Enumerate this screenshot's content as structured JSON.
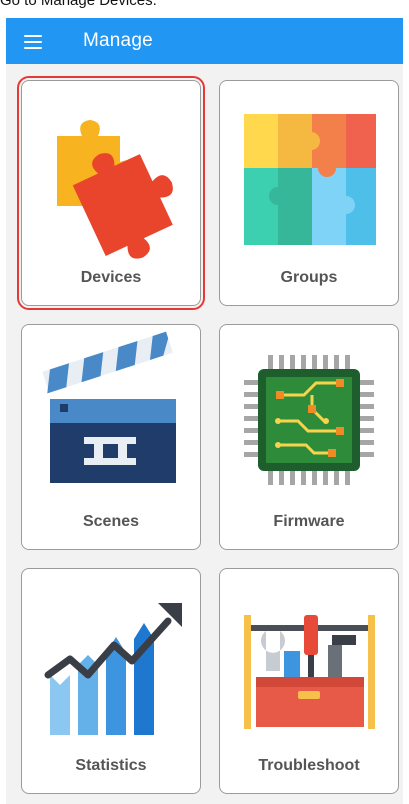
{
  "caption": "Go to Manage Devices.",
  "appbar": {
    "title": "Manage",
    "menu_icon": "menu-icon",
    "color": "#2196f3"
  },
  "cards": [
    {
      "label": "Devices",
      "icon": "puzzle-pieces-icon",
      "selected": true
    },
    {
      "label": "Groups",
      "icon": "puzzle-grid-icon",
      "selected": false
    },
    {
      "label": "Scenes",
      "icon": "clapperboard-icon",
      "selected": false
    },
    {
      "label": "Firmware",
      "icon": "chip-icon",
      "selected": false
    },
    {
      "label": "Statistics",
      "icon": "growth-chart-icon",
      "selected": false
    },
    {
      "label": "Troubleshoot",
      "icon": "toolbox-icon",
      "selected": false
    }
  ],
  "colors": {
    "selection_outline": "#e53935",
    "background": "#f2f2f2",
    "card_label": "#555555"
  }
}
